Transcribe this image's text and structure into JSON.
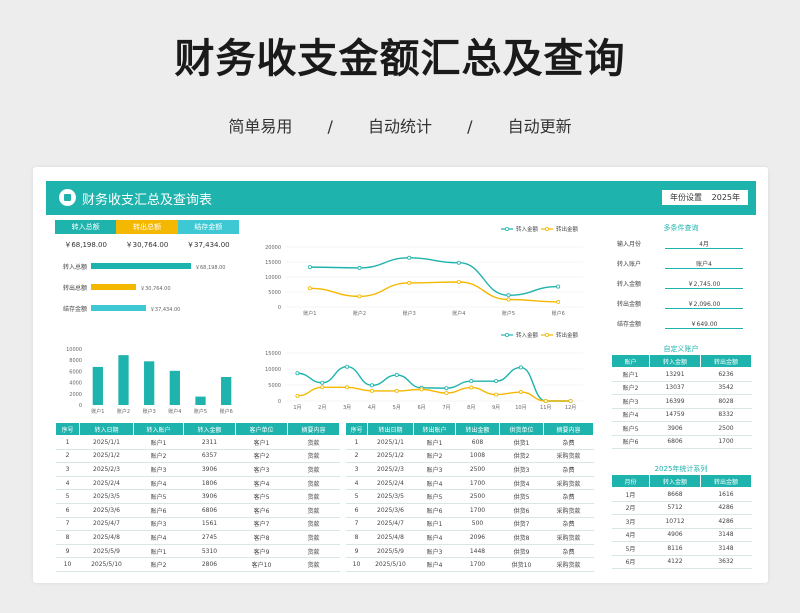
{
  "header": {
    "title": "财务收支金额汇总及查询",
    "tags": [
      "简单易用",
      "/",
      "自动统计",
      "/",
      "自动更新"
    ]
  },
  "dashboard": {
    "title": "财务收支汇总及查询表",
    "year_label": "年份设置",
    "year_value": "2025年",
    "colors": {
      "teal": "#1fb3ad",
      "orange": "#f5b800",
      "cyan": "#3ec8d4"
    }
  },
  "summary": {
    "tabs": [
      "转入总额",
      "转出总额",
      "结存金额"
    ],
    "values": [
      "￥68,198.00",
      "￥30,764.00",
      "￥37,434.00"
    ],
    "bars": [
      {
        "label": "转入总额",
        "value": "￥68,198.00",
        "ratio": 1.0
      },
      {
        "label": "转出总额",
        "value": "￥30,764.00",
        "ratio": 0.451
      },
      {
        "label": "结存金额",
        "value": "￥37,434.00",
        "ratio": 0.549
      }
    ]
  },
  "chart_data": [
    {
      "type": "line",
      "categories": [
        "账户1",
        "账户2",
        "账户3",
        "账户4",
        "账户5",
        "账户6"
      ],
      "series": [
        {
          "name": "转入金额",
          "values": [
            13291,
            13037,
            16399,
            14759,
            3906,
            6806
          ]
        },
        {
          "name": "转出金额",
          "values": [
            6236,
            3542,
            8028,
            8332,
            2500,
            1700
          ]
        }
      ],
      "yticks": [
        "0",
        "5000",
        "10000",
        "15000",
        "20000"
      ],
      "ylim": [
        0,
        20000
      ]
    },
    {
      "type": "bar",
      "categories": [
        "账户1",
        "账户2",
        "账户3",
        "账户4",
        "账户5",
        "账户6"
      ],
      "values": [
        6800,
        8900,
        7800,
        6100,
        1500,
        5000
      ],
      "yticks": [
        "0",
        "2000",
        "4000",
        "6000",
        "8000",
        "10000"
      ],
      "ylim": [
        0,
        10000
      ]
    },
    {
      "type": "line",
      "categories": [
        "1月",
        "2月",
        "3月",
        "4月",
        "5月",
        "6月",
        "7月",
        "8月",
        "9月",
        "10月",
        "11月",
        "12月"
      ],
      "series": [
        {
          "name": "转入金额",
          "values": [
            8668,
            5712,
            10712,
            4906,
            8116,
            4122,
            4000,
            6200,
            6200,
            10500,
            0,
            0
          ]
        },
        {
          "name": "转出金额",
          "values": [
            1616,
            4286,
            4286,
            3148,
            3148,
            3632,
            2500,
            4200,
            2000,
            2800,
            0,
            0
          ]
        }
      ],
      "yticks": [
        "0",
        "5000",
        "10000",
        "15000"
      ],
      "ylim": [
        0,
        15000
      ]
    }
  ],
  "income_table": {
    "headers": [
      "序号",
      "转入日期",
      "转入账户",
      "转入金额",
      "客户单位",
      "摘要内容"
    ],
    "rows": [
      [
        "1",
        "2025/1/1",
        "账户1",
        "2311",
        "客户1",
        "货款"
      ],
      [
        "2",
        "2025/1/2",
        "账户2",
        "6357",
        "客户2",
        "货款"
      ],
      [
        "3",
        "2025/2/3",
        "账户3",
        "3906",
        "客户3",
        "货款"
      ],
      [
        "4",
        "2025/2/4",
        "账户4",
        "1806",
        "客户4",
        "货款"
      ],
      [
        "5",
        "2025/3/5",
        "账户5",
        "3906",
        "客户5",
        "货款"
      ],
      [
        "6",
        "2025/3/6",
        "账户6",
        "6806",
        "客户6",
        "货款"
      ],
      [
        "7",
        "2025/4/7",
        "账户3",
        "1561",
        "客户7",
        "货款"
      ],
      [
        "8",
        "2025/4/8",
        "账户4",
        "2745",
        "客户8",
        "货款"
      ],
      [
        "9",
        "2025/5/9",
        "账户1",
        "5310",
        "客户9",
        "货款"
      ],
      [
        "10",
        "2025/5/10",
        "账户2",
        "2806",
        "客户10",
        "货款"
      ]
    ]
  },
  "expense_table": {
    "headers": [
      "序号",
      "转出日期",
      "转出账户",
      "转出金额",
      "供货单位",
      "摘要内容"
    ],
    "rows": [
      [
        "1",
        "2025/1/1",
        "账户1",
        "608",
        "供货1",
        "杂费"
      ],
      [
        "2",
        "2025/1/2",
        "账户2",
        "1008",
        "供货2",
        "采购货款"
      ],
      [
        "3",
        "2025/2/3",
        "账户3",
        "2500",
        "供货3",
        "杂费"
      ],
      [
        "4",
        "2025/2/4",
        "账户4",
        "1700",
        "供货4",
        "采购货款"
      ],
      [
        "5",
        "2025/3/5",
        "账户5",
        "2500",
        "供货5",
        "杂费"
      ],
      [
        "6",
        "2025/3/6",
        "账户6",
        "1700",
        "供货6",
        "采购货款"
      ],
      [
        "7",
        "2025/4/7",
        "账户1",
        "500",
        "供货7",
        "杂费"
      ],
      [
        "8",
        "2025/4/8",
        "账户4",
        "2096",
        "供货8",
        "采购货款"
      ],
      [
        "9",
        "2025/5/9",
        "账户3",
        "1448",
        "供货9",
        "杂费"
      ],
      [
        "10",
        "2025/5/10",
        "账户4",
        "1700",
        "供货10",
        "采购货款"
      ]
    ]
  },
  "query": {
    "title": "多条件查询",
    "rows": [
      {
        "label": "输入月份",
        "value": "4月"
      },
      {
        "label": "转入账户",
        "value": "账户4"
      },
      {
        "label": "转入金额",
        "value": "￥2,745.00"
      },
      {
        "label": "转出金额",
        "value": "￥2,096.00"
      },
      {
        "label": "结存金额",
        "value": "￥649.00"
      }
    ]
  },
  "custom_account": {
    "title": "自定义账户",
    "headers": [
      "账户",
      "转入金额",
      "转出金额"
    ],
    "rows": [
      [
        "账户1",
        "13291",
        "6236"
      ],
      [
        "账户2",
        "13037",
        "3542"
      ],
      [
        "账户3",
        "16399",
        "8028"
      ],
      [
        "账户4",
        "14759",
        "8332"
      ],
      [
        "账户5",
        "3906",
        "2500"
      ],
      [
        "账户6",
        "6806",
        "1700"
      ]
    ]
  },
  "yearly_stats": {
    "title": "2025年统计系列",
    "headers": [
      "月份",
      "转入金额",
      "转出金额"
    ],
    "rows": [
      [
        "1月",
        "8668",
        "1616"
      ],
      [
        "2月",
        "5712",
        "4286"
      ],
      [
        "3月",
        "10712",
        "4286"
      ],
      [
        "4月",
        "4906",
        "3148"
      ],
      [
        "5月",
        "8116",
        "3148"
      ],
      [
        "6月",
        "4122",
        "3632"
      ]
    ]
  }
}
